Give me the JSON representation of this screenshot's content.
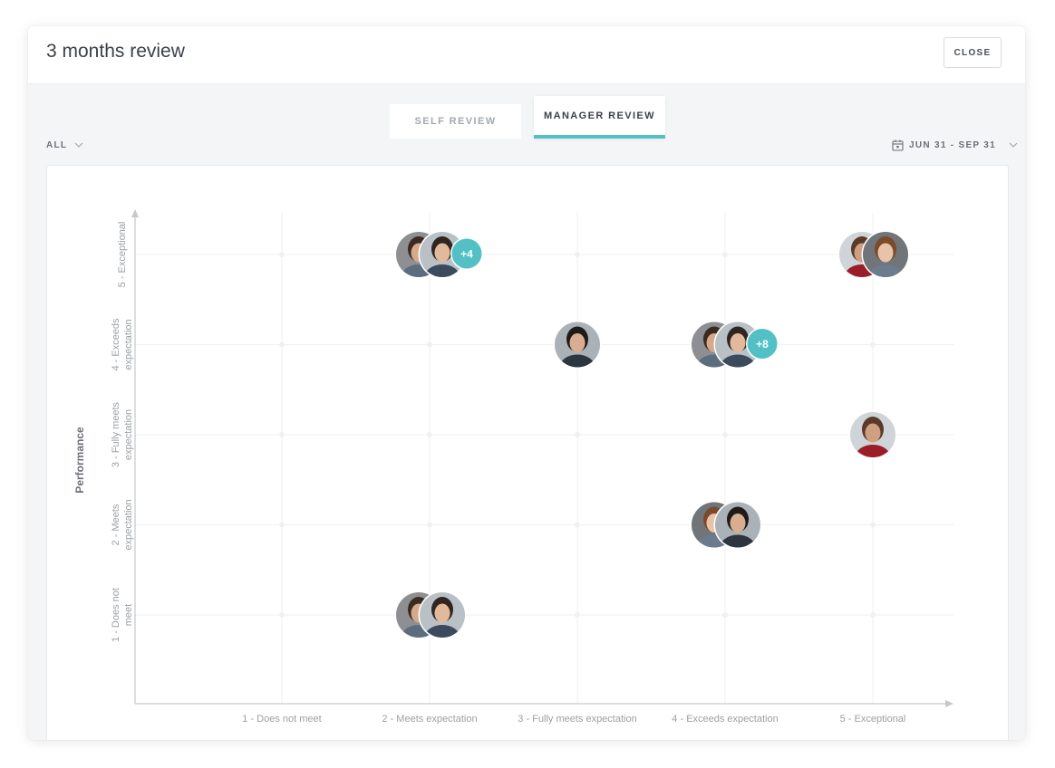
{
  "modal": {
    "title": "3 months review",
    "close_label": "CLOSE"
  },
  "tabs": [
    {
      "label": "SELF REVIEW",
      "active": false
    },
    {
      "label": "MANAGER REVIEW",
      "active": true
    }
  ],
  "filter": {
    "selected": "ALL"
  },
  "date_range": {
    "label": "JUN 31 - SEP 31"
  },
  "colors": {
    "accent": "#52c0c5",
    "grid": "#eef0f2",
    "axis": "#c5c9cd"
  },
  "chart_data": {
    "type": "scatter",
    "ylabel": "Performance",
    "xlabel": "",
    "x_categories": [
      "1 - Does not meet",
      "2 - Meets expectation",
      "3 - Fully meets expectation",
      "4 - Exceeds expectation",
      "5 - Exceptional"
    ],
    "y_categories": [
      [
        "1 - Does not",
        "meet"
      ],
      [
        "2 - Meets",
        "expectation"
      ],
      [
        "3 - Fully meets",
        "expectation"
      ],
      [
        "4 - Exceeds",
        "expectation"
      ],
      [
        "5 - Exceptional"
      ]
    ],
    "points": [
      {
        "x": 2,
        "y": 5,
        "avatars": 2,
        "extra": "+4"
      },
      {
        "x": 5,
        "y": 5,
        "avatars": 2,
        "extra": ""
      },
      {
        "x": 3,
        "y": 4,
        "avatars": 1,
        "extra": ""
      },
      {
        "x": 4,
        "y": 4,
        "avatars": 2,
        "extra": "+8"
      },
      {
        "x": 5,
        "y": 3,
        "avatars": 1,
        "extra": ""
      },
      {
        "x": 4,
        "y": 2,
        "avatars": 2,
        "extra": ""
      },
      {
        "x": 2,
        "y": 1,
        "avatars": 2,
        "extra": ""
      }
    ]
  }
}
